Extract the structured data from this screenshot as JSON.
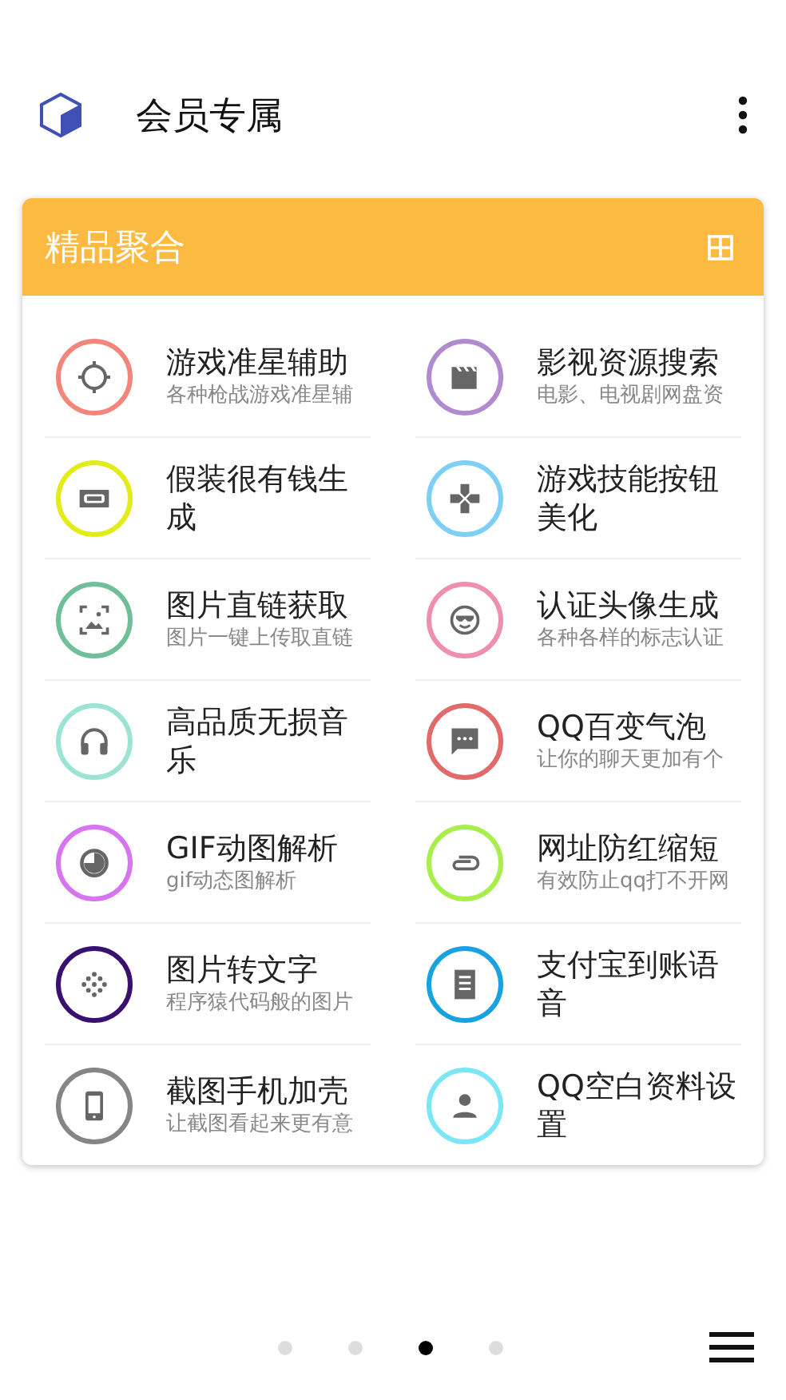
{
  "app_bar": {
    "title": "会员专属"
  },
  "card": {
    "title": "精品聚合",
    "items": [
      {
        "title": "游戏准星辅助",
        "subtitle": "各种枪战游戏准星辅",
        "color": "#f3857a",
        "kind": "crosshair"
      },
      {
        "title": "影视资源搜索",
        "subtitle": "电影、电视剧网盘资",
        "color": "#b18bd0",
        "kind": "clapper"
      },
      {
        "title": "假装很有钱生成",
        "color": "#e2ec16",
        "kind": "banknote"
      },
      {
        "title": "游戏技能按钮美化",
        "color": "#7ecff5",
        "kind": "gamepad"
      },
      {
        "title": "图片直链获取",
        "subtitle": "图片一键上传取直链",
        "color": "#6fbf98",
        "kind": "image"
      },
      {
        "title": "认证头像生成",
        "subtitle": "各种各样的标志认证",
        "color": "#ef8fb0",
        "kind": "face"
      },
      {
        "title": "高品质无损音乐",
        "color": "#9be3d4",
        "kind": "headphones"
      },
      {
        "title": "QQ百变气泡",
        "subtitle": "让你的聊天更加有个",
        "color": "#e26a6a",
        "kind": "chat"
      },
      {
        "title": "GIF动图解析",
        "subtitle": "gif动态图解析",
        "color": "#d774f0",
        "kind": "timer"
      },
      {
        "title": "网址防红缩短",
        "subtitle": "有效防止qq打不开网",
        "color": "#a8ef4e",
        "kind": "clip"
      },
      {
        "title": "图片转文字",
        "subtitle": "程序猿代码般的图片",
        "color": "#3a0f72",
        "kind": "dots"
      },
      {
        "title": "支付宝到账语音",
        "color": "#18a2e0",
        "kind": "receipt"
      },
      {
        "title": "截图手机加壳",
        "subtitle": "让截图看起来更有意",
        "color": "#858585",
        "kind": "phone"
      },
      {
        "title": "QQ空白资料设置",
        "color": "#7be6f5",
        "kind": "person"
      }
    ]
  },
  "pager": [
    {
      "selected": false
    },
    {
      "selected": false
    },
    {
      "selected": true
    },
    {
      "selected": false
    }
  ]
}
